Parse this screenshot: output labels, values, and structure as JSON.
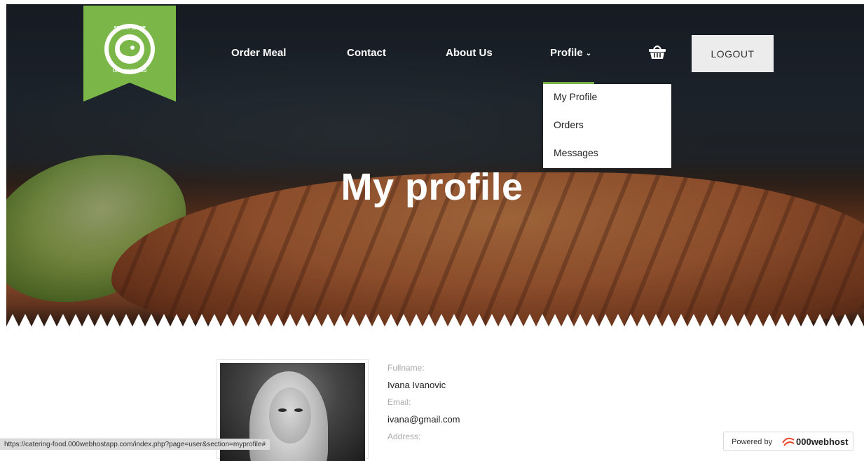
{
  "nav": {
    "items": [
      {
        "label": "Order Meal"
      },
      {
        "label": "Contact"
      },
      {
        "label": "About Us"
      },
      {
        "label": "Profile"
      }
    ],
    "logout_label": "LOGOUT",
    "cart_icon": "basket-icon",
    "accent_color": "#7ab648"
  },
  "logo": {
    "top_text": "STEAK SHOP",
    "bottom_text": "100% CERTIFIED",
    "icon": "steak-icon"
  },
  "dropdown": {
    "items": [
      {
        "label": "My Profile"
      },
      {
        "label": "Orders"
      },
      {
        "label": "Messages"
      }
    ]
  },
  "hero": {
    "title": "My profile"
  },
  "profile": {
    "fields": [
      {
        "label": "Fullname:",
        "value": "Ivana Ivanovic"
      },
      {
        "label": "Email:",
        "value": "ivana@gmail.com"
      },
      {
        "label": "Address:",
        "value": ""
      }
    ]
  },
  "statusbar": {
    "url": "https://catering-food.000webhostapp.com/index.php?page=user&section=myprofile#"
  },
  "powered": {
    "prefix": "Powered by",
    "brand": "000webhost"
  }
}
